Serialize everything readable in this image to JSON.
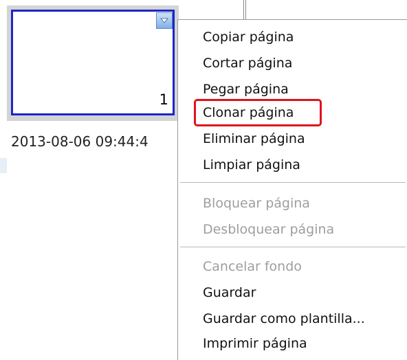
{
  "thumbnail": {
    "page_number": "1",
    "timestamp": "2013-08-06 09:44:4"
  },
  "context_menu": {
    "group1": [
      {
        "label": "Copiar página",
        "enabled": true
      },
      {
        "label": "Cortar página",
        "enabled": true
      },
      {
        "label": "Pegar página",
        "enabled": true
      },
      {
        "label": "Clonar página",
        "enabled": true,
        "highlighted": true
      },
      {
        "label": "Eliminar página",
        "enabled": true
      },
      {
        "label": "Limpiar página",
        "enabled": true
      }
    ],
    "group2": [
      {
        "label": "Bloquear página",
        "enabled": false
      },
      {
        "label": "Desbloquear página",
        "enabled": false
      }
    ],
    "group3": [
      {
        "label": "Cancelar fondo",
        "enabled": false
      },
      {
        "label": "Guardar",
        "enabled": true
      },
      {
        "label": "Guardar como plantilla...",
        "enabled": true
      },
      {
        "label": "Imprimir página",
        "enabled": true
      }
    ]
  },
  "colors": {
    "thumbnail_border": "#1c25c8",
    "highlight": "#e0121b",
    "disabled_text": "#9e9e9e"
  }
}
